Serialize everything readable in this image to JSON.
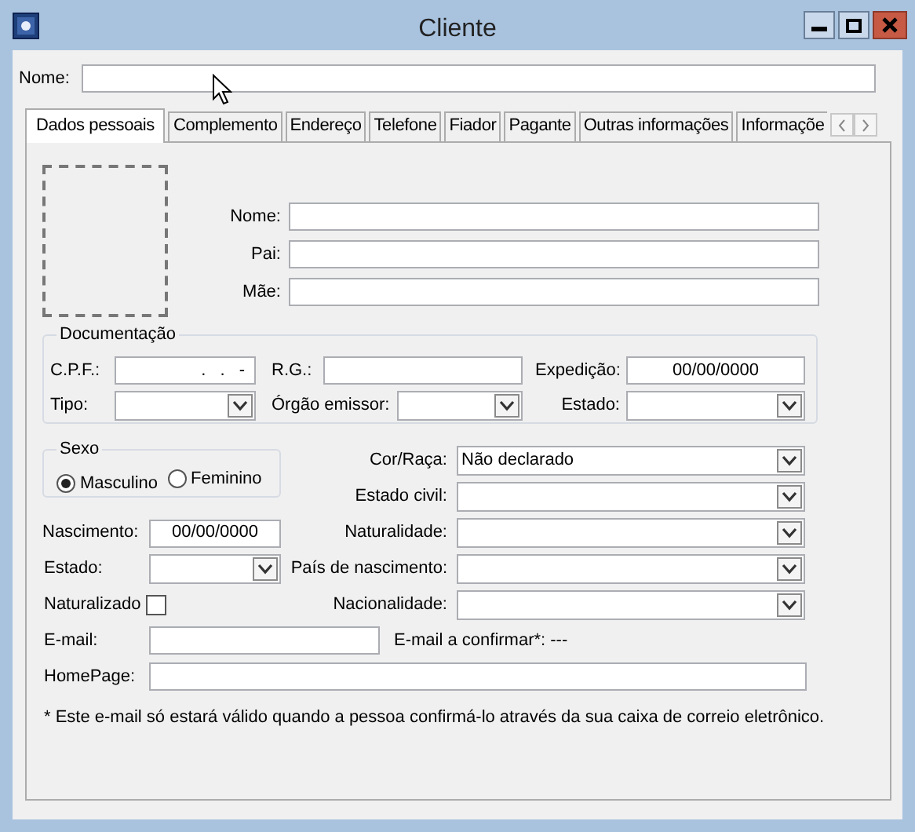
{
  "window": {
    "title": "Cliente"
  },
  "name_field": {
    "label": "Nome:"
  },
  "tabs": [
    {
      "label": "Dados pessoais",
      "selected": true
    },
    {
      "label": "Complemento",
      "selected": false
    },
    {
      "label": "Endereço",
      "selected": false
    },
    {
      "label": "Telefone",
      "selected": false
    },
    {
      "label": "Fiador",
      "selected": false
    },
    {
      "label": "Pagante",
      "selected": false
    },
    {
      "label": "Outras informações",
      "selected": false
    },
    {
      "label": "Informaçõe",
      "selected": false
    }
  ],
  "person_fields": [
    {
      "label": "Nome:"
    },
    {
      "label": "Pai:"
    },
    {
      "label": "Mãe:"
    }
  ],
  "documentation": {
    "legend": "Documentação",
    "fields": [
      {
        "kind": "masked",
        "label": "C.P.F.:",
        "value": ". . -"
      },
      {
        "kind": "text",
        "label": "R.G.:"
      },
      {
        "kind": "date",
        "label": "Expedição:",
        "value": "00/00/0000"
      },
      {
        "kind": "select",
        "label": "Tipo:"
      },
      {
        "kind": "select",
        "label": "Órgão emissor:"
      },
      {
        "kind": "select",
        "label": "Estado:"
      }
    ]
  },
  "sex": {
    "legend": "Sexo",
    "options": [
      {
        "label": "Masculino",
        "selected": true
      },
      {
        "label": "Feminino",
        "selected": false
      }
    ]
  },
  "birth": {
    "label": "Nascimento:",
    "value": "00/00/0000"
  },
  "birth_state": {
    "label": "Estado:"
  },
  "naturalized": {
    "label": "Naturalizado",
    "checked": false
  },
  "right_selects": [
    {
      "label": "Cor/Raça:",
      "value": "Não declarado"
    },
    {
      "label": "Estado civil:"
    },
    {
      "label": "Naturalidade:"
    },
    {
      "label": "País de nascimento:"
    },
    {
      "label": "Nacionalidade:"
    }
  ],
  "email": {
    "label": "E-mail:"
  },
  "email_confirm": "E-mail a confirmar*: ---",
  "homepage": {
    "label": "HomePage:"
  },
  "note": "* Este e-mail só estará válido quando a pessoa confirmá-lo através da sua caixa de correio eletrônico."
}
